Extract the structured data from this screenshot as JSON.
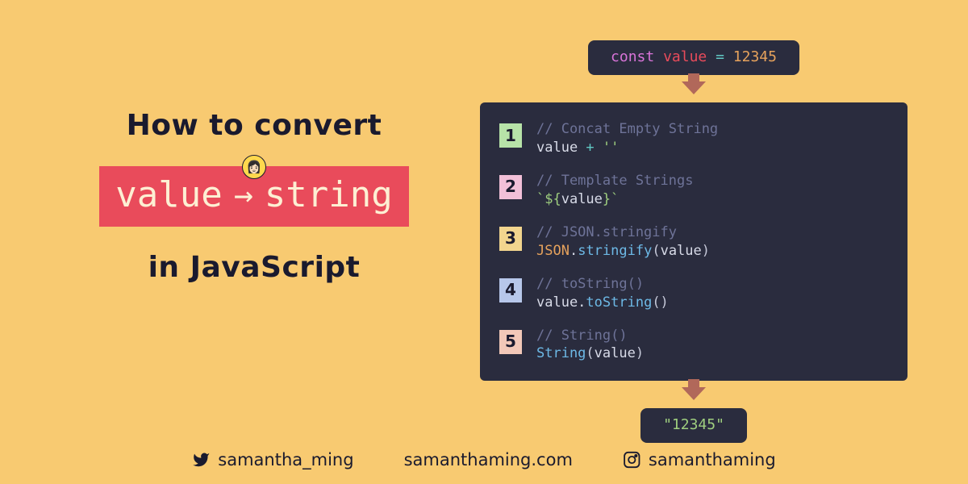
{
  "title": {
    "line1": "How to convert",
    "pill_left": "value",
    "pill_right": "string",
    "line2": "in JavaScript"
  },
  "declaration": {
    "keyword": "const",
    "varname": "value",
    "operator": "=",
    "number": "12345"
  },
  "methods": [
    {
      "num": "1",
      "badge_bg": "#b7e3a8",
      "comment": "// Concat Empty String",
      "code_html": "value <span class='kw-op'>+</span> <span class='kw-str'>''</span>"
    },
    {
      "num": "2",
      "badge_bg": "#f2c0d8",
      "comment": "// Template Strings",
      "code_html": "<span class='kw-str'>`${</span>value<span class='kw-str'>}`</span>"
    },
    {
      "num": "3",
      "badge_bg": "#f2d58e",
      "comment": "// JSON.stringify",
      "code_html": "<span class='kw-obj'>JSON</span>.<span class='kw-fn'>stringify</span><span class='kw-paren'>(</span>value<span class='kw-paren'>)</span>"
    },
    {
      "num": "4",
      "badge_bg": "#b7c7ea",
      "comment": "// toString()",
      "code_html": "value.<span class='kw-fn'>toString</span><span class='kw-paren'>()</span>"
    },
    {
      "num": "5",
      "badge_bg": "#f2c8b8",
      "comment": "// String()",
      "code_html": "<span class='kw-fn'>String</span><span class='kw-paren'>(</span>value<span class='kw-paren'>)</span>"
    }
  ],
  "result": "\"12345\"",
  "socials": {
    "twitter": "samantha_ming",
    "website": "samanthaming.com",
    "instagram": "samanthaming"
  },
  "colors": {
    "bg": "#f8ca71",
    "panel": "#2a2c3e",
    "accent": "#e94b5b"
  }
}
